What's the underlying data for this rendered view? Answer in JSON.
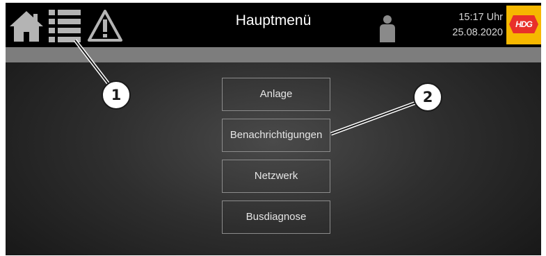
{
  "header": {
    "title": "Hauptmenü",
    "time": "15:17 Uhr",
    "date": "25.08.2020",
    "logo_text": "HDG",
    "icons": [
      "home-icon",
      "list-icon",
      "warning-icon",
      "user-icon"
    ]
  },
  "menu": {
    "items": [
      {
        "label": "Anlage"
      },
      {
        "label": "Benachrichtigungen"
      },
      {
        "label": "Netzwerk"
      },
      {
        "label": "Busdiagnose"
      }
    ]
  },
  "callouts": [
    "1",
    "2"
  ],
  "colors": {
    "topbar": "#000000",
    "graybar": "#7d7d7d",
    "logo_bg": "#f6b800",
    "logo_red": "#e8302a",
    "button_border": "#8c8c8c"
  }
}
